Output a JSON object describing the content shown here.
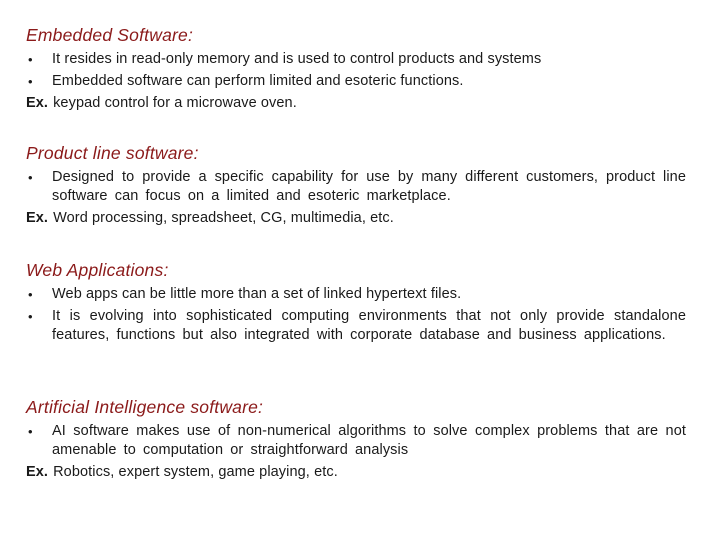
{
  "sections": [
    {
      "heading": "Embedded Software:",
      "bullets": [
        "It resides in read-only memory and is used to control products and systems",
        "Embedded software  can perform limited and esoteric functions."
      ],
      "example_label": "Ex.",
      "example_text": "keypad control for a microwave oven."
    },
    {
      "heading": "Product line software:",
      "bullets": [
        "Designed to provide a specific capability for use by many different customers, product line software can focus on a limited and esoteric marketplace."
      ],
      "example_label": "Ex.",
      "example_text": "Word processing, spreadsheet, CG, multimedia, etc."
    },
    {
      "heading": "Web Applications:",
      "bullets": [
        "Web apps can be little more than a set of linked hypertext files.",
        "It is evolving into sophisticated computing environments that not only provide standalone features, functions but also integrated with corporate database and business applications."
      ]
    },
    {
      "heading": "Artificial Intelligence software:",
      "bullets": [
        "AI software makes use of non-numerical algorithms to solve complex problems that are not amenable to computation or straightforward analysis"
      ],
      "example_label": "Ex.",
      "example_text": "Robotics, expert system, game playing, etc."
    }
  ],
  "bullet_glyph": "•",
  "colors": {
    "heading": "#8b1a1a",
    "body_text": "#1a1a1a",
    "background": "#ffffff"
  }
}
